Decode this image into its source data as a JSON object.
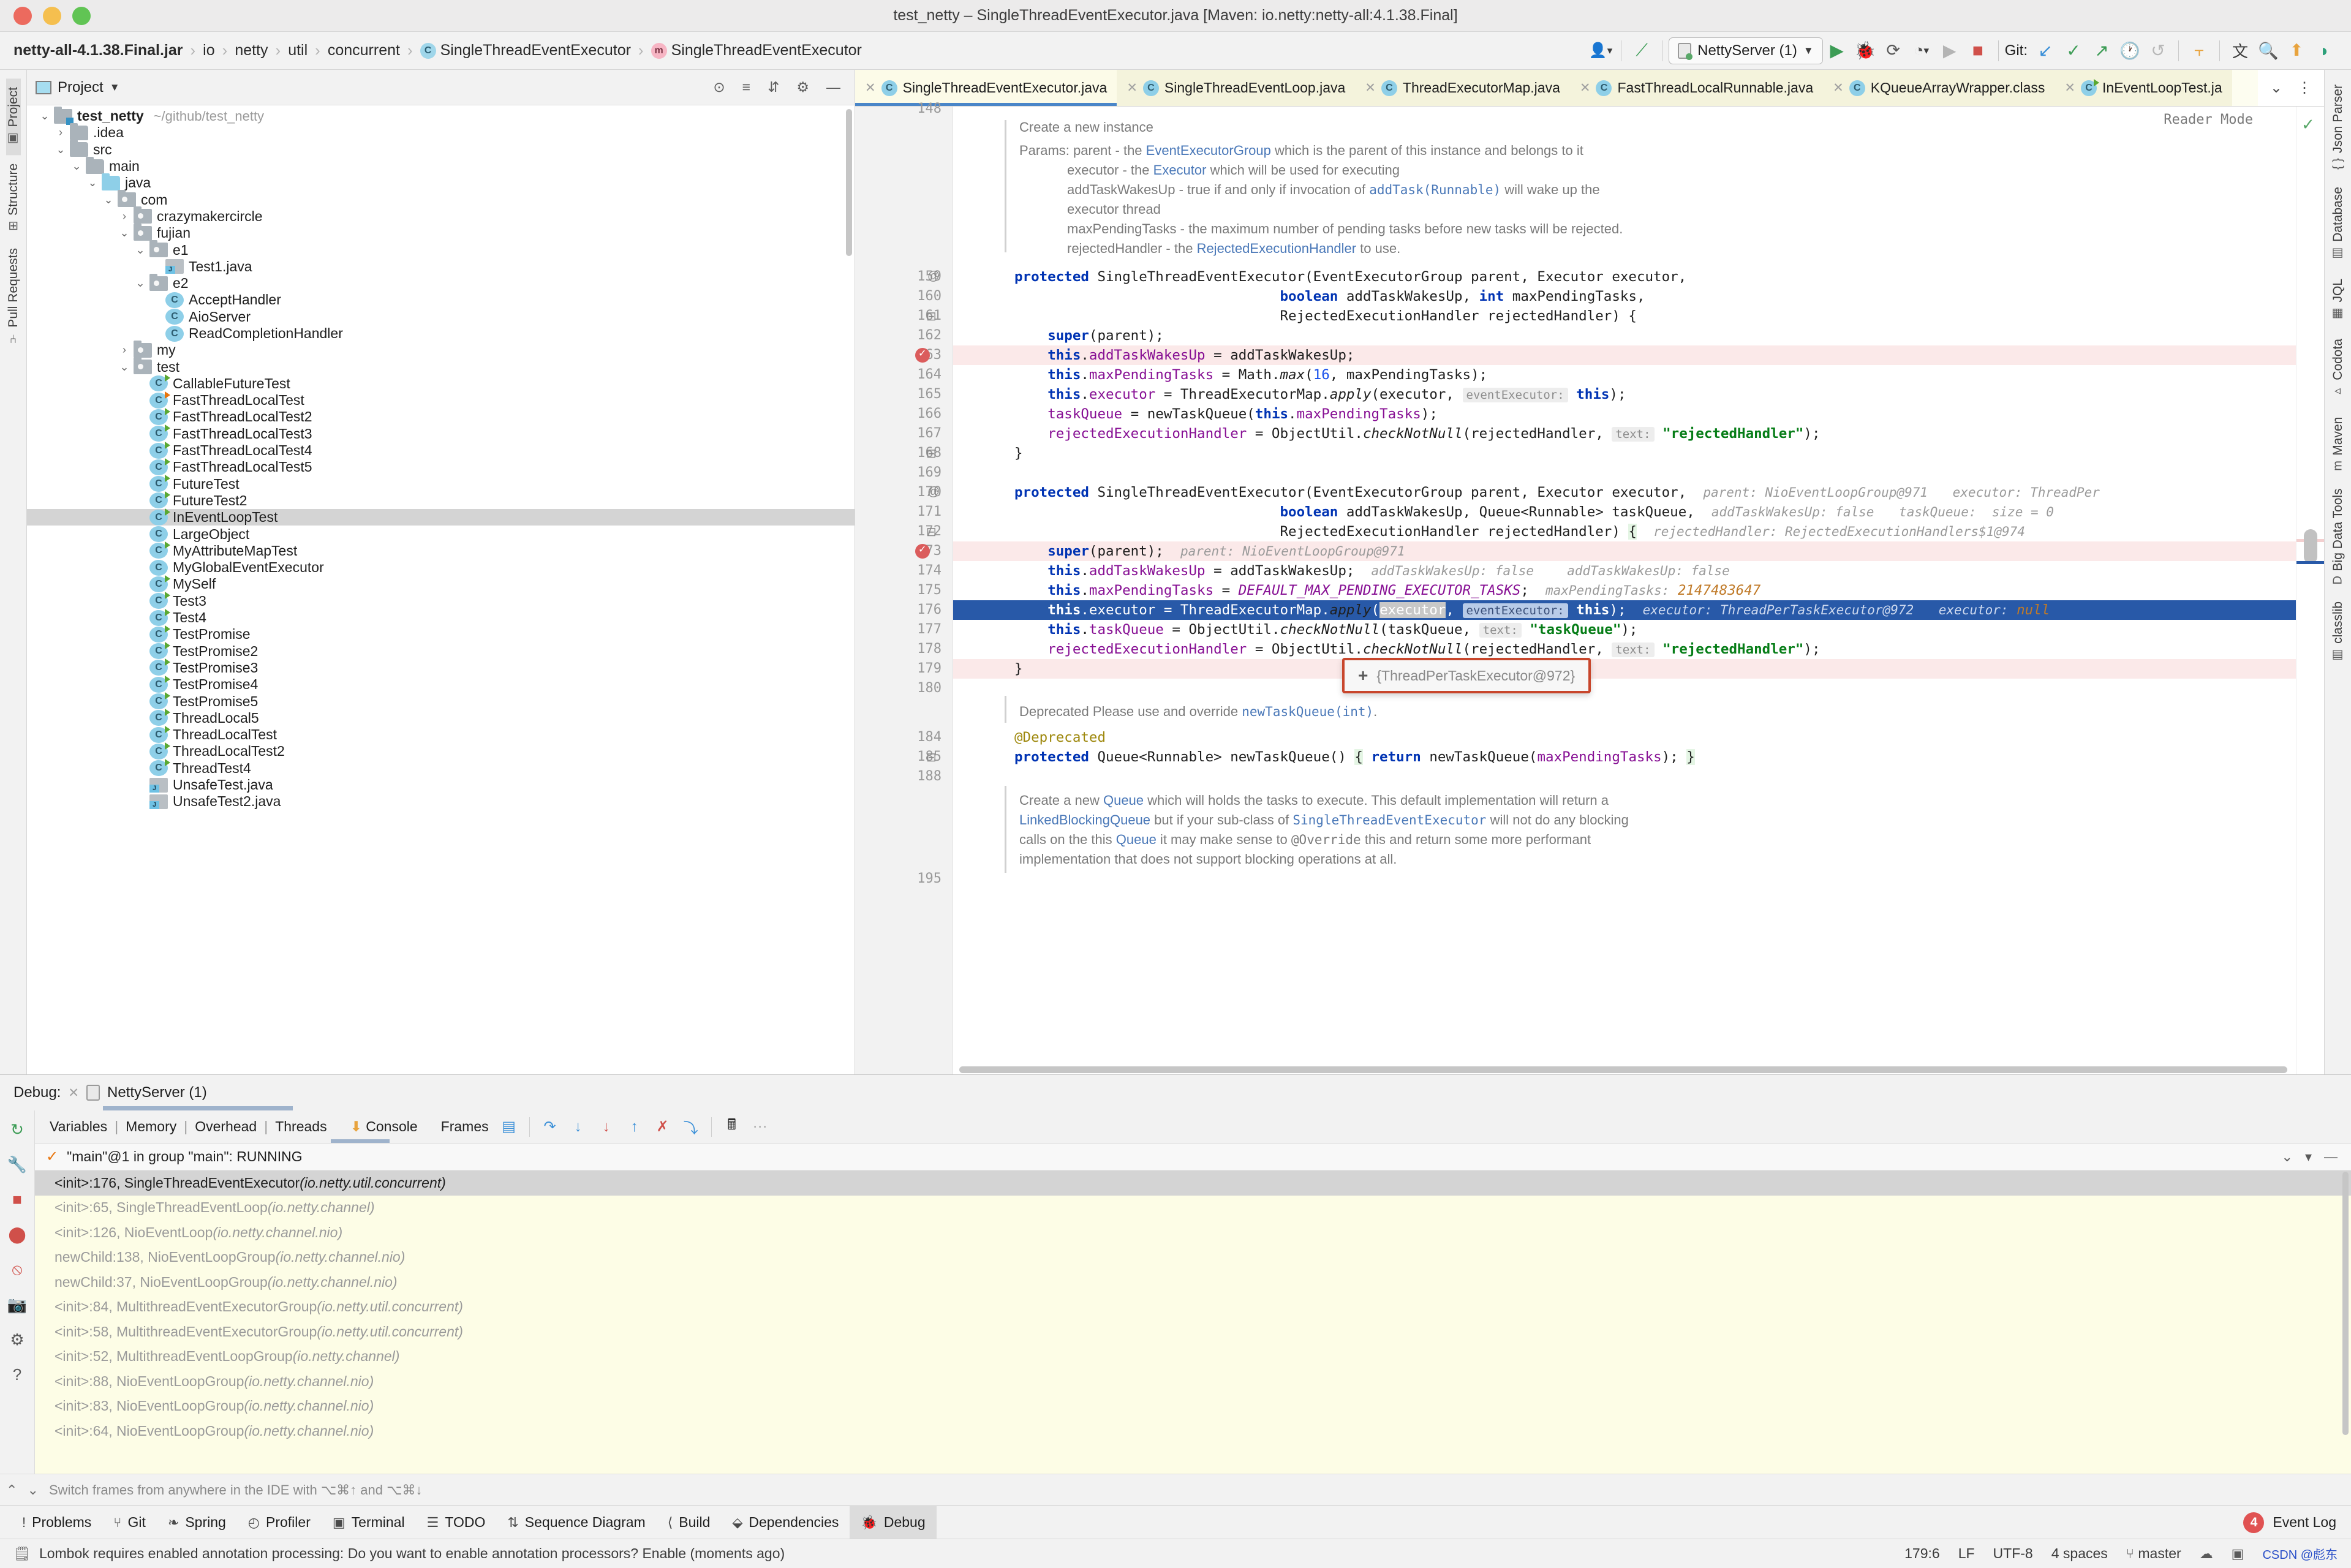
{
  "window": {
    "title": "test_netty – SingleThreadEventExecutor.java [Maven: io.netty:netty-all:4.1.38.Final]"
  },
  "breadcrumb": {
    "items": [
      {
        "label": "netty-all-4.1.38.Final.jar",
        "icon": "jar-icon",
        "bold": true
      },
      {
        "label": "io",
        "icon": ""
      },
      {
        "label": "netty",
        "icon": ""
      },
      {
        "label": "util",
        "icon": ""
      },
      {
        "label": "concurrent",
        "icon": ""
      },
      {
        "label": "SingleThreadEventExecutor",
        "icon": "class-icon"
      },
      {
        "label": "SingleThreadEventExecutor",
        "icon": "method-icon"
      }
    ]
  },
  "toolbar": {
    "run_config": "NettyServer (1)",
    "git_label": "Git:",
    "icons": [
      "user-avatar-icon",
      "build-hammer-icon",
      "run-icon",
      "debug-icon",
      "run-with-coverage-icon",
      "profile-icon",
      "attach-icon",
      "stop-icon",
      "git-update-icon",
      "git-commit-icon",
      "git-push-icon",
      "git-history-icon",
      "git-rollback-icon",
      "bookmark-icon",
      "translate-icon",
      "search-everywhere-icon",
      "inspection-icon",
      "ide-settings-icon"
    ]
  },
  "left_rail": {
    "items": [
      {
        "label": "Project",
        "icon": "project-icon",
        "selected": true
      },
      {
        "label": "Structure",
        "icon": "structure-icon",
        "selected": false
      },
      {
        "label": "Pull Requests",
        "icon": "pull-requests-icon",
        "selected": false
      }
    ]
  },
  "project_panel": {
    "title": "Project",
    "header_icons": [
      "locate-icon",
      "expand-all-icon",
      "collapse-all-icon",
      "settings-gear-icon",
      "hide-icon"
    ],
    "tree": [
      {
        "depth": 0,
        "twisty": "v",
        "icon": "project-root-icon",
        "label": "test_netty",
        "bold": true,
        "path": "~/github/test_netty"
      },
      {
        "depth": 1,
        "twisty": ">",
        "icon": "folder-icon",
        "label": ".idea"
      },
      {
        "depth": 1,
        "twisty": "v",
        "icon": "folder-icon",
        "label": "src"
      },
      {
        "depth": 2,
        "twisty": "v",
        "icon": "folder-icon",
        "label": "main"
      },
      {
        "depth": 3,
        "twisty": "v",
        "icon": "source-folder-icon",
        "label": "java"
      },
      {
        "depth": 4,
        "twisty": "v",
        "icon": "package-icon",
        "label": "com"
      },
      {
        "depth": 5,
        "twisty": ">",
        "icon": "package-icon",
        "label": "crazymakercircle"
      },
      {
        "depth": 5,
        "twisty": "v",
        "icon": "package-icon",
        "label": "fujian"
      },
      {
        "depth": 6,
        "twisty": "v",
        "icon": "package-icon",
        "label": "e1"
      },
      {
        "depth": 7,
        "twisty": "",
        "icon": "java-file-icon",
        "label": "Test1.java"
      },
      {
        "depth": 6,
        "twisty": "v",
        "icon": "package-icon",
        "label": "e2"
      },
      {
        "depth": 7,
        "twisty": "",
        "icon": "class-icon",
        "label": "AcceptHandler"
      },
      {
        "depth": 7,
        "twisty": "",
        "icon": "class-icon",
        "label": "AioServer"
      },
      {
        "depth": 7,
        "twisty": "",
        "icon": "class-icon",
        "label": "ReadCompletionHandler"
      },
      {
        "depth": 5,
        "twisty": ">",
        "icon": "package-icon",
        "label": "my"
      },
      {
        "depth": 5,
        "twisty": "v",
        "icon": "package-icon",
        "label": "test"
      },
      {
        "depth": 6,
        "twisty": "",
        "icon": "class-runnable-icon",
        "label": "CallableFutureTest"
      },
      {
        "depth": 6,
        "twisty": "",
        "icon": "class-runnable-orange-icon",
        "label": "FastThreadLocalTest"
      },
      {
        "depth": 6,
        "twisty": "",
        "icon": "class-runnable-icon",
        "label": "FastThreadLocalTest2"
      },
      {
        "depth": 6,
        "twisty": "",
        "icon": "class-runnable-icon",
        "label": "FastThreadLocalTest3"
      },
      {
        "depth": 6,
        "twisty": "",
        "icon": "class-runnable-icon",
        "label": "FastThreadLocalTest4"
      },
      {
        "depth": 6,
        "twisty": "",
        "icon": "class-runnable-icon",
        "label": "FastThreadLocalTest5"
      },
      {
        "depth": 6,
        "twisty": "",
        "icon": "class-runnable-icon",
        "label": "FutureTest"
      },
      {
        "depth": 6,
        "twisty": "",
        "icon": "class-runnable-icon",
        "label": "FutureTest2"
      },
      {
        "depth": 6,
        "twisty": "",
        "icon": "class-runnable-icon",
        "label": "InEventLoopTest",
        "selected": true
      },
      {
        "depth": 6,
        "twisty": "",
        "icon": "class-icon",
        "label": "LargeObject"
      },
      {
        "depth": 6,
        "twisty": "",
        "icon": "class-runnable-icon",
        "label": "MyAttributeMapTest"
      },
      {
        "depth": 6,
        "twisty": "",
        "icon": "class-icon",
        "label": "MyGlobalEventExecutor"
      },
      {
        "depth": 6,
        "twisty": "",
        "icon": "class-runnable-icon",
        "label": "MySelf"
      },
      {
        "depth": 6,
        "twisty": "",
        "icon": "class-runnable-icon",
        "label": "Test3"
      },
      {
        "depth": 6,
        "twisty": "",
        "icon": "class-runnable-icon",
        "label": "Test4"
      },
      {
        "depth": 6,
        "twisty": "",
        "icon": "class-runnable-icon",
        "label": "TestPromise"
      },
      {
        "depth": 6,
        "twisty": "",
        "icon": "class-runnable-icon",
        "label": "TestPromise2"
      },
      {
        "depth": 6,
        "twisty": "",
        "icon": "class-runnable-icon",
        "label": "TestPromise3"
      },
      {
        "depth": 6,
        "twisty": "",
        "icon": "class-runnable-icon",
        "label": "TestPromise4"
      },
      {
        "depth": 6,
        "twisty": "",
        "icon": "class-runnable-icon",
        "label": "TestPromise5"
      },
      {
        "depth": 6,
        "twisty": "",
        "icon": "class-runnable-icon",
        "label": "ThreadLocal5"
      },
      {
        "depth": 6,
        "twisty": "",
        "icon": "class-runnable-icon",
        "label": "ThreadLocalTest"
      },
      {
        "depth": 6,
        "twisty": "",
        "icon": "class-runnable-icon",
        "label": "ThreadLocalTest2"
      },
      {
        "depth": 6,
        "twisty": "",
        "icon": "class-runnable-icon",
        "label": "ThreadTest4"
      },
      {
        "depth": 6,
        "twisty": "",
        "icon": "java-file-icon",
        "label": "UnsafeTest.java"
      },
      {
        "depth": 6,
        "twisty": "",
        "icon": "java-file-icon",
        "label": "UnsafeTest2.java"
      }
    ]
  },
  "editor": {
    "tabs": [
      {
        "label": "SingleThreadEventExecutor.java",
        "icon": "class-icon",
        "active": true
      },
      {
        "label": "SingleThreadEventLoop.java",
        "icon": "class-icon",
        "active": false
      },
      {
        "label": "ThreadExecutorMap.java",
        "icon": "class-icon",
        "active": false
      },
      {
        "label": "FastThreadLocalRunnable.java",
        "icon": "class-icon",
        "active": false
      },
      {
        "label": "KQueueArrayWrapper.class",
        "icon": "class-icon",
        "active": false
      },
      {
        "label": "InEventLoopTest.ja",
        "icon": "class-runnable-icon",
        "active": false
      }
    ],
    "tab_controls": [
      "chevron-down-icon",
      "more-vertical-icon"
    ],
    "reader_mode": "Reader Mode",
    "line_numbers": [
      "148",
      "159",
      "160",
      "161",
      "162",
      "163",
      "164",
      "165",
      "166",
      "167",
      "168",
      "169",
      "170",
      "171",
      "172",
      "173",
      "174",
      "175",
      "176",
      "177",
      "178",
      "179",
      "180",
      "184",
      "185",
      "188",
      "195"
    ],
    "javadoc_top": {
      "summary": "Create a new instance",
      "params_label": "Params:",
      "lines": [
        "parent - the EventExecutorGroup which is the parent of this instance and belongs to it",
        "executor - the Executor which will be used for executing",
        "addTaskWakesUp - true if and only if invocation of addTask(Runnable) will wake up the",
        "executor thread",
        "maxPendingTasks - the maximum number of pending tasks before new tasks will be rejected.",
        "rejectedHandler - the RejectedExecutionHandler to use."
      ]
    },
    "javadoc_deprecated": "Deprecated Please use and override newTaskQueue(int).",
    "javadoc_bottom": [
      "Create a new Queue which will holds the tasks to execute. This default implementation will return a",
      "LinkedBlockingQueue but if your sub-class of SingleThreadEventExecutor will not do any blocking",
      "calls on the this Queue it may make sense to @Override this and return some more performant",
      "implementation that does not support blocking operations at all."
    ],
    "inline_values": {
      "parent": "parent: NioEventLoopGroup@971",
      "executor": "executor: ThreadPer",
      "addTaskWakesUp": "addTaskWakesUp: false",
      "taskQueue": "taskQueue:  size = 0",
      "rejectedHandler": "rejectedHandler: RejectedExecutionHandlers$1@974",
      "line173_parent": "parent: NioEventLoopGroup@971",
      "line174_a": "addTaskWakesUp: false",
      "line174_b": "addTaskWakesUp: false",
      "line175": "maxPendingTasks:",
      "line175_val": "2147483647",
      "line176_a": "executor: ThreadPerTaskExecutor@972",
      "line176_b": "executor:",
      "line176_null": "null"
    },
    "param_hints": {
      "eventExecutor": "eventExecutor:",
      "text": "text:"
    },
    "popup": {
      "plus": "+",
      "text": "{ThreadPerTaskExecutor@972}"
    }
  },
  "right_rail": {
    "items": [
      {
        "label": "Json Parser",
        "icon": "json-parser-icon"
      },
      {
        "label": "Database",
        "icon": "database-icon"
      },
      {
        "label": "JQL",
        "icon": "jql-icon"
      },
      {
        "label": "Codota",
        "icon": "codota-icon"
      },
      {
        "label": "Maven",
        "icon": "maven-icon"
      },
      {
        "label": "Big Data Tools",
        "icon": "big-data-tools-icon"
      },
      {
        "label": "classlib",
        "icon": "classlib-icon"
      }
    ]
  },
  "debug": {
    "panel_label": "Debug:",
    "session": "NettyServer (1)",
    "tabs": [
      "Variables",
      "Memory",
      "Overhead",
      "Threads"
    ],
    "console_tab": "Console",
    "frames_tab": "Frames",
    "toolbar_icons": [
      "show-execution-point-icon",
      "step-over-icon",
      "step-into-icon",
      "force-step-into-icon",
      "step-out-icon",
      "drop-frame-icon",
      "run-to-cursor-icon",
      "evaluate-expression-icon",
      "mute-breakpoints-icon"
    ],
    "rail_icons": [
      "rerun-icon",
      "settings-wrench-icon",
      "stop-icon",
      "breakpoints-icon",
      "mute-breakpoints-icon",
      "camera-icon",
      "gear-icon",
      "help-icon"
    ],
    "thread_status": "\"main\"@1 in group \"main\": RUNNING",
    "thread_right_icons": [
      "filter-icon",
      "chevron-down-icon",
      "hide-icon"
    ],
    "frames": [
      {
        "text": "<init>:176, SingleThreadEventExecutor",
        "pkg": "(io.netty.util.concurrent)",
        "selected": true
      },
      {
        "text": "<init>:65, SingleThreadEventLoop",
        "pkg": "(io.netty.channel)",
        "selected": false
      },
      {
        "text": "<init>:126, NioEventLoop",
        "pkg": "(io.netty.channel.nio)",
        "selected": false
      },
      {
        "text": "newChild:138, NioEventLoopGroup",
        "pkg": "(io.netty.channel.nio)",
        "selected": false
      },
      {
        "text": "newChild:37, NioEventLoopGroup",
        "pkg": "(io.netty.channel.nio)",
        "selected": false
      },
      {
        "text": "<init>:84, MultithreadEventExecutorGroup",
        "pkg": "(io.netty.util.concurrent)",
        "selected": false
      },
      {
        "text": "<init>:58, MultithreadEventExecutorGroup",
        "pkg": "(io.netty.util.concurrent)",
        "selected": false
      },
      {
        "text": "<init>:52, MultithreadEventLoopGroup",
        "pkg": "(io.netty.channel)",
        "selected": false
      },
      {
        "text": "<init>:88, NioEventLoopGroup",
        "pkg": "(io.netty.channel.nio)",
        "selected": false
      },
      {
        "text": "<init>:83, NioEventLoopGroup",
        "pkg": "(io.netty.channel.nio)",
        "selected": false
      },
      {
        "text": "<init>:64, NioEventLoopGroup",
        "pkg": "(io.netty.channel.nio)",
        "selected": false
      }
    ],
    "hint": "Switch frames from anywhere in the IDE with ⌥⌘↑ and ⌥⌘↓"
  },
  "bottom_toolwindows": {
    "items": [
      {
        "label": "Problems",
        "icon": "problems-icon",
        "active": false
      },
      {
        "label": "Git",
        "icon": "git-icon",
        "active": false
      },
      {
        "label": "Spring",
        "icon": "spring-icon",
        "active": false
      },
      {
        "label": "Profiler",
        "icon": "profiler-icon",
        "active": false
      },
      {
        "label": "Terminal",
        "icon": "terminal-icon",
        "active": false
      },
      {
        "label": "TODO",
        "icon": "todo-icon",
        "active": false
      },
      {
        "label": "Sequence Diagram",
        "icon": "sequence-diagram-icon",
        "active": false
      },
      {
        "label": "Build",
        "icon": "build-icon",
        "active": false
      },
      {
        "label": "Dependencies",
        "icon": "dependencies-icon",
        "active": false
      },
      {
        "label": "Debug",
        "icon": "debug-icon",
        "active": true
      }
    ],
    "event_log": "Event Log",
    "event_log_count": "4"
  },
  "status_bar": {
    "message": "Lombok requires enabled annotation processing: Do you want to enable annotation processors? Enable (moments ago)",
    "caret_position": "179:6",
    "line_separator": "LF",
    "encoding": "UTF-8",
    "indent": "4 spaces",
    "branch": "master",
    "watermark": "CSDN @彪东"
  },
  "colors": {
    "accent": "#4a86c8",
    "selection": "#2859a8",
    "breakpoint": "#db5c5c",
    "keyword": "#0033b3",
    "field": "#871094",
    "string": "#067d17",
    "number": "#1750eb",
    "annotation": "#9e880d",
    "inline_value": "#9a9a9a"
  }
}
